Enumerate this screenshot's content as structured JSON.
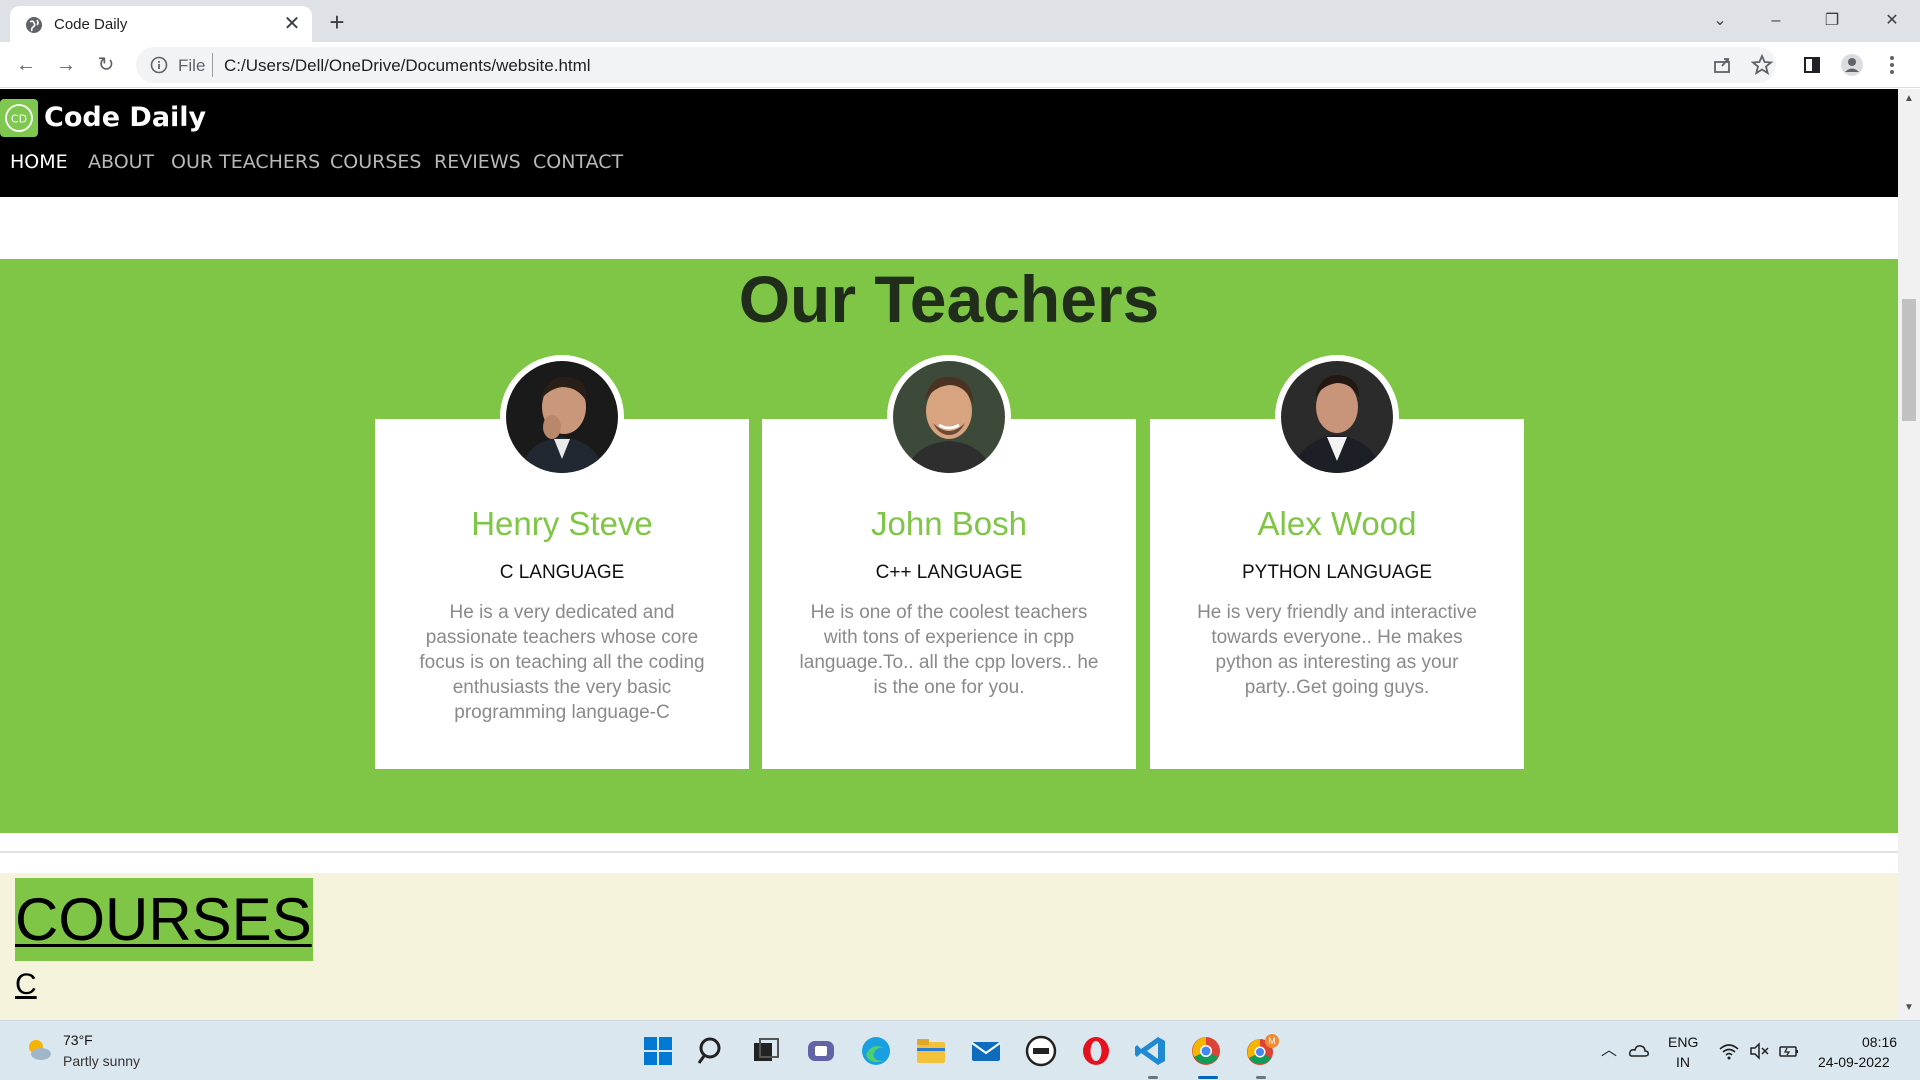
{
  "browser": {
    "tab_title": "Code Daily",
    "address_scheme": "File",
    "address_url": "C:/Users/Dell/OneDrive/Documents/website.html"
  },
  "site": {
    "brand": "Code Daily",
    "logo_text": "CD",
    "nav": [
      {
        "label": "HOME",
        "active": true
      },
      {
        "label": "ABOUT",
        "active": false
      },
      {
        "label": "OUR TEACHERS",
        "active": false
      },
      {
        "label": "COURSES",
        "active": false
      },
      {
        "label": "REVIEWS",
        "active": false
      },
      {
        "label": "CONTACT",
        "active": false
      }
    ],
    "teachers_section": {
      "title": "Our Teachers",
      "teachers": [
        {
          "name": "Henry Steve",
          "subject": "C LANGUAGE",
          "description": "He is a very dedicated and passionate teachers whose core focus is on teaching all the coding enthusiasts the very basic programming language-C"
        },
        {
          "name": "John Bosh",
          "subject": "C++ LANGUAGE",
          "description": "He is one of the coolest teachers with tons of experience in cpp language.To.. all the cpp lovers.. he is the one for you."
        },
        {
          "name": "Alex Wood",
          "subject": "PYTHON LANGUAGE",
          "description": "He is very friendly and interactive towards everyone.. He makes python as interesting as your party..Get going guys."
        }
      ]
    },
    "courses_section": {
      "title": "COURSES",
      "first_course": "C"
    }
  },
  "taskbar": {
    "weather_temp": "73°F",
    "weather_desc": "Partly sunny",
    "lang_line1": "ENG",
    "lang_line2": "IN",
    "time": "08:16",
    "date": "24-09-2022",
    "chrome_badge": "M"
  },
  "colors": {
    "accent_green": "#80c646",
    "nav_bg": "#000000",
    "courses_bg": "#f5f3dc"
  }
}
